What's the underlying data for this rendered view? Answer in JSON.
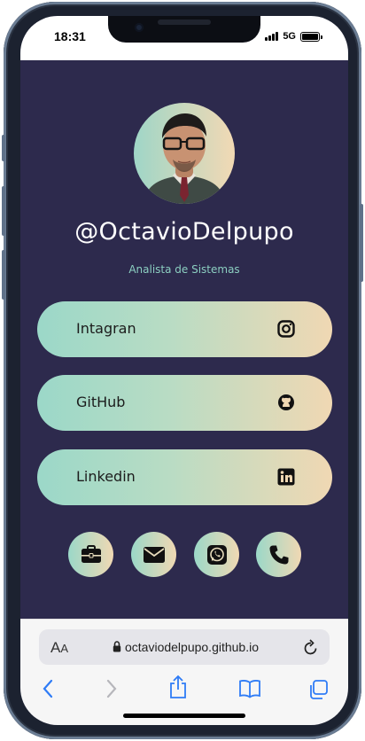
{
  "status_bar": {
    "time": "18:31",
    "network": "5G",
    "signal_bars": 4,
    "battery_level": 1.0
  },
  "profile": {
    "username": "@OctavioDelpupo",
    "subtitle": "Analista de Sistemas"
  },
  "links": [
    {
      "label": "Intagran",
      "icon": "instagram-icon"
    },
    {
      "label": "GitHub",
      "icon": "github-icon"
    },
    {
      "label": "Linkedin",
      "icon": "linkedin-icon"
    }
  ],
  "contact_icons": [
    "briefcase-icon",
    "envelope-icon",
    "whatsapp-icon",
    "phone-icon"
  ],
  "browser": {
    "aa_big": "A",
    "aa_small": "A",
    "url": "octaviodelpupo.github.io",
    "toolbar": [
      "back-icon",
      "forward-icon",
      "share-icon",
      "bookmarks-icon",
      "tabs-icon"
    ]
  },
  "colors": {
    "background": "#2d2a4d",
    "gradient_start": "#9bd8c8",
    "gradient_end": "#f0d8b3",
    "subtitle": "#8ccfc1",
    "safari_blue": "#2f7cf6"
  }
}
